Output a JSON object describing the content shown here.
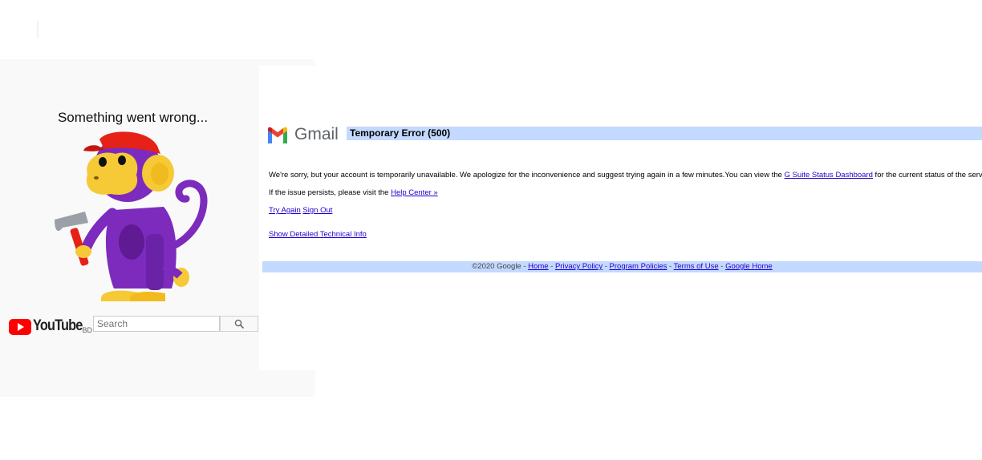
{
  "youtube": {
    "error_title": "Something went wrong...",
    "logo_text": "YouTube",
    "country_code": "BD",
    "search": {
      "placeholder": "Search"
    },
    "search_button_icon": "search-icon"
  },
  "gmail": {
    "logo_text": "Gmail",
    "error_title": "Temporary Error (500)",
    "message_part1": "We're sorry, but your account is temporarily unavailable. We apologize for the inconvenience and suggest trying again in a few minutes.You can view the ",
    "status_dashboard_link": "G Suite Status Dashboard",
    "message_part2": " for the current status of the service.",
    "persist_text": "If the issue persists, please visit the ",
    "help_center_link": "Help Center »",
    "try_again_link": "Try Again",
    "sign_out_link": "Sign Out",
    "tech_info_link": "Show Detailed Technical Info",
    "footer": {
      "copyright": "©2020 Google - ",
      "links": [
        "Home",
        "Privacy Policy",
        "Program Policies",
        "Terms of Use",
        "Google Home"
      ],
      "separator": " - "
    }
  },
  "colors": {
    "gmail_bar": "#c3d9ff",
    "link": "#2200cc",
    "youtube_red": "#ff0000",
    "monkey_purple": "#7d2bbc"
  }
}
